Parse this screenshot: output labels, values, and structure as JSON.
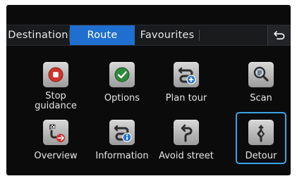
{
  "tabs": [
    {
      "label": "Destination",
      "active": false
    },
    {
      "label": "Route",
      "active": true
    },
    {
      "label": "Favourites",
      "active": false
    }
  ],
  "back_icon": "back-arrow-icon",
  "menu": [
    {
      "label": "Stop guidance",
      "icon": "stop-icon"
    },
    {
      "label": "Options",
      "icon": "checkmark-icon"
    },
    {
      "label": "Plan tour",
      "icon": "plan-tour-icon"
    },
    {
      "label": "Scan",
      "icon": "scan-icon"
    },
    {
      "label": "Overview",
      "icon": "overview-icon"
    },
    {
      "label": "Information",
      "icon": "information-icon"
    },
    {
      "label": "Avoid street",
      "icon": "avoid-street-icon"
    },
    {
      "label": "Detour",
      "icon": "detour-icon",
      "selected": true
    }
  ],
  "colors": {
    "active_tab": "#1e6fd0",
    "selection": "#3aa4e6",
    "stop_red": "#d0342c",
    "options_green": "#2e8a3a",
    "info_blue": "#2a78c8"
  }
}
